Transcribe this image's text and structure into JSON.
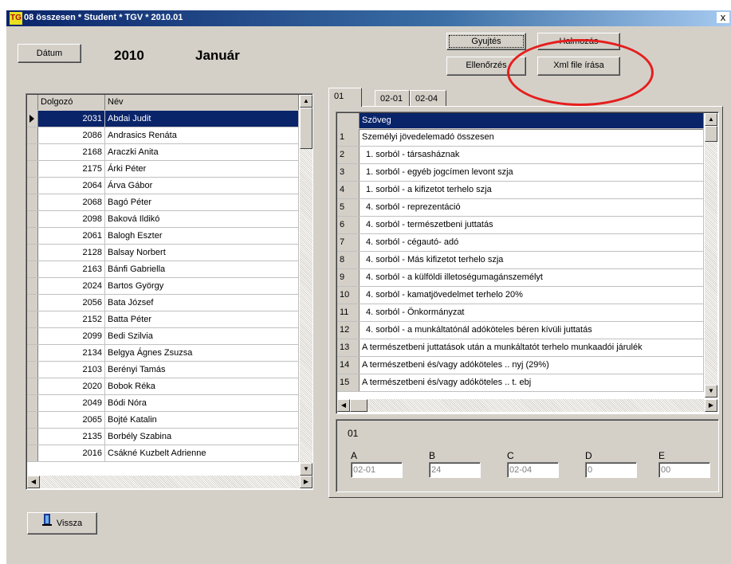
{
  "window": {
    "title": "08 összesen *  Student  * TGV * 2010.01",
    "app_icon_glyph": "TG",
    "close_glyph": "x"
  },
  "header": {
    "date_button": "Dátum",
    "year": "2010",
    "month": "Január"
  },
  "toolbar": {
    "gyujtes": "Gyujtés",
    "halmozas": "Halmozás",
    "ellenorzes": "Ellenőrzés",
    "xml": "Xml file írása"
  },
  "employees": {
    "columns": [
      "Dolgozó",
      "Név"
    ],
    "rows": [
      [
        "2031",
        "Abdai Judit"
      ],
      [
        "2086",
        "Andrasics Renáta"
      ],
      [
        "2168",
        "Araczki Anita"
      ],
      [
        "2175",
        "Árki Péter"
      ],
      [
        "2064",
        "Árva Gábor"
      ],
      [
        "2068",
        "Bagó Péter"
      ],
      [
        "2098",
        "Baková Ildikó"
      ],
      [
        "2061",
        "Balogh Eszter"
      ],
      [
        "2128",
        "Balsay Norbert"
      ],
      [
        "2163",
        "Bánfi Gabriella"
      ],
      [
        "2024",
        "Bartos György"
      ],
      [
        "2056",
        "Bata József"
      ],
      [
        "2152",
        "Batta Péter"
      ],
      [
        "2099",
        "Bedi Szilvia"
      ],
      [
        "2134",
        "Belgya Ágnes Zsuzsa"
      ],
      [
        "2103",
        "Berényi Tamás"
      ],
      [
        "2020",
        "Bobok Réka"
      ],
      [
        "2049",
        "Bódi Nóra"
      ],
      [
        "2065",
        "Bojté Katalin"
      ],
      [
        "2135",
        "Borbély Szabina"
      ],
      [
        "2016",
        "Csákné Kuzbelt Adrienne"
      ]
    ],
    "selected_index": 0
  },
  "tabs": [
    "01",
    "02-01",
    "02-04"
  ],
  "active_tab": 0,
  "items": {
    "column": "Szöveg",
    "rows": [
      [
        "1",
        "Személyi jövedelemadó összesen"
      ],
      [
        "2",
        "1. sorból - társasháznak"
      ],
      [
        "3",
        "1. sorból - egyéb jogcímen levont szja"
      ],
      [
        "4",
        "1. sorból - a kifizetot terhelo szja"
      ],
      [
        "5",
        "4. sorból - reprezentáció"
      ],
      [
        "6",
        "4. sorból - természetbeni juttatás"
      ],
      [
        "7",
        "4. sorból - cégautó- adó"
      ],
      [
        "8",
        "4. sorból - Más  kifizetot terhelo szja"
      ],
      [
        "9",
        "4. sorból - a külföldi illetoségumagánszemélyt"
      ],
      [
        "10",
        "4. sorból - kamatjövedelmet terhelo 20%"
      ],
      [
        "11",
        "4. sorból - Önkormányzat"
      ],
      [
        "12",
        "4. sorból - a munkáltatónál adóköteles béren kívüli juttatás"
      ],
      [
        "13",
        "A természetbeni juttatások után a munkáltatót terhelo munkaadói járulék"
      ],
      [
        "14",
        "A természetbeni és/vagy adóköteles .. nyj (29%)"
      ],
      [
        "15",
        "A természetbeni és/vagy adóköteles .. t. ebj"
      ]
    ]
  },
  "detail": {
    "code": "01",
    "fields": [
      {
        "label": "A",
        "value": "02-01"
      },
      {
        "label": "B",
        "value": "24"
      },
      {
        "label": "C",
        "value": "02-04"
      },
      {
        "label": "D",
        "value": "0"
      },
      {
        "label": "E",
        "value": "00"
      }
    ]
  },
  "footer": {
    "back_button": "Vissza"
  },
  "colors": {
    "title_bar": "#0a246a",
    "selection": "#0a246a",
    "annotation": "#e51e1e",
    "window_bg": "#d4d0c8"
  }
}
